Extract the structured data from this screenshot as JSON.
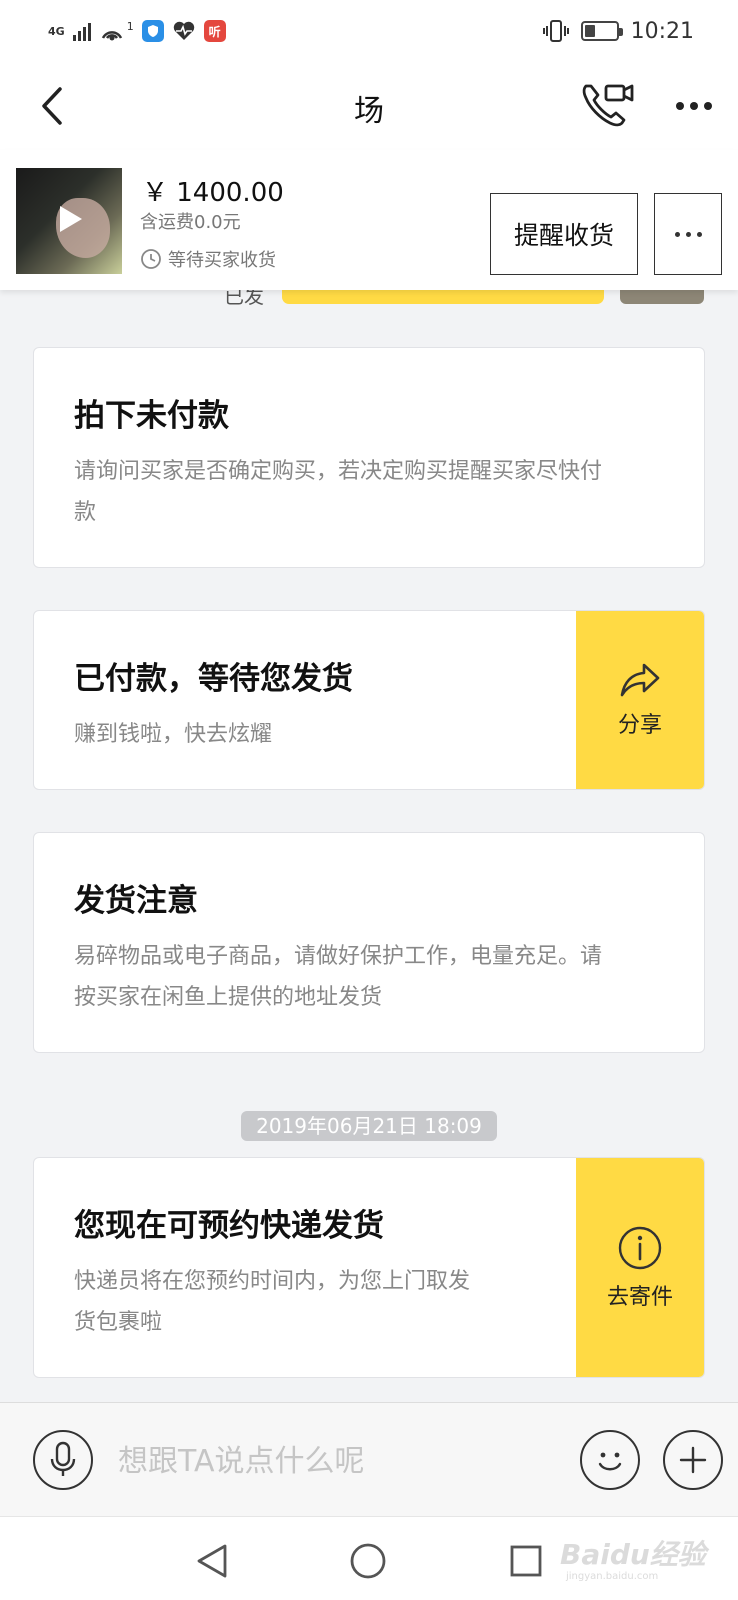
{
  "status_bar": {
    "network_label": "4G",
    "sim_indicator": "1",
    "app_icon_text": "听",
    "time": "10:21",
    "battery_level_percent": 35,
    "icons": [
      "signal-icon",
      "hotspot-icon",
      "shield-app-icon",
      "health-app-icon",
      "listen-app-icon",
      "vibrate-icon",
      "battery-icon"
    ]
  },
  "nav": {
    "title": "场",
    "back_icon": "chevron-left-icon",
    "call_icon": "phone-video-icon",
    "more_icon": "more-dots-icon"
  },
  "order": {
    "price": "￥ 1400.00",
    "shipping": "含运费0.0元",
    "status": "等待买家收货",
    "remind_button": "提醒收货",
    "thumbnail_icon": "play-icon"
  },
  "peek": {
    "text": "已发"
  },
  "cards": {
    "unpaid": {
      "title": "拍下未付款",
      "desc_line1": "请询问买家是否确定购买，若决定购买提醒买家尽快付",
      "desc_line2": "款"
    },
    "paid": {
      "title": "已付款，等待您发货",
      "desc": "赚到钱啦，快去炫耀",
      "action_label": "分享",
      "action_icon": "share-icon"
    },
    "shipping_notice": {
      "title": "发货注意",
      "desc_line1": "易碎物品或电子商品，请做好保护工作，电量充足。请",
      "desc_line2": "按买家在闲鱼上提供的地址发货"
    },
    "courier": {
      "title": "您现在可预约快递发货",
      "desc_line1": "快递员将在您预约时间内，为您上门取发",
      "desc_line2": "货包裹啦",
      "action_label": "去寄件",
      "action_icon": "info-icon"
    }
  },
  "timestamp": "2019年06月21日 18:09",
  "input_bar": {
    "placeholder": "想跟TA说点什么呢",
    "value": "",
    "voice_icon": "microphone-icon",
    "emoji_icon": "smiley-icon",
    "plus_icon": "plus-icon"
  },
  "system_nav": {
    "back_icon": "triangle-back-icon",
    "home_icon": "circle-home-icon",
    "recents_icon": "square-recents-icon"
  },
  "watermark": {
    "text": "Baidu经验",
    "url": "jingyan.baidu.com"
  },
  "colors": {
    "accent_yellow": "#ffda44",
    "background": "#f2f3f5",
    "card_border": "#e1e2e6",
    "muted_text": "#888888"
  }
}
